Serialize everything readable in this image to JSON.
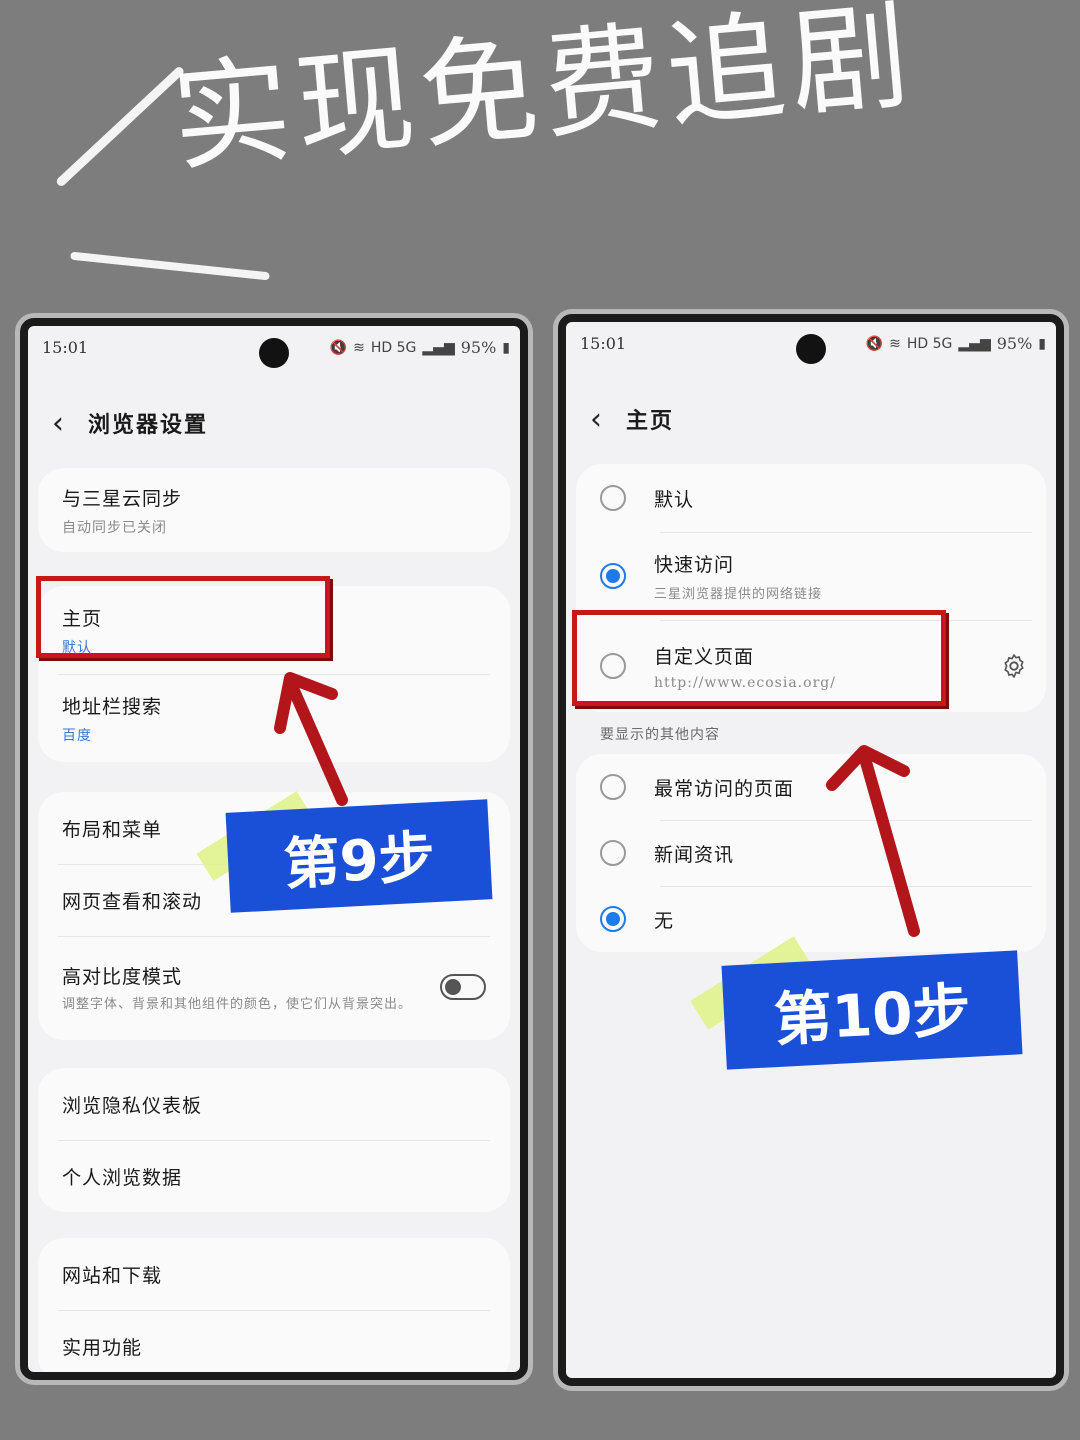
{
  "headline": "实现免费追剧",
  "left_phone": {
    "status": {
      "time": "15:01",
      "battery": "95%",
      "network": "HD 5G"
    },
    "title": "浏览器设置",
    "group1": [
      {
        "label": "与三星云同步",
        "sub": "自动同步已关闭"
      }
    ],
    "group2": [
      {
        "label": "主页",
        "sub": "默认"
      },
      {
        "label": "地址栏搜索",
        "sub": "百度"
      }
    ],
    "group3": [
      {
        "label": "布局和菜单"
      },
      {
        "label": "网页查看和滚动"
      },
      {
        "label": "高对比度模式",
        "sub": "调整字体、背景和其他组件的颜色，使它们从背景突出。",
        "toggle_on": false
      }
    ],
    "group4": [
      {
        "label": "浏览隐私仪表板"
      },
      {
        "label": "个人浏览数据"
      }
    ],
    "group5": [
      {
        "label": "网站和下载"
      },
      {
        "label": "实用功能"
      }
    ],
    "step_label": "第9步"
  },
  "right_phone": {
    "status": {
      "time": "15:01",
      "battery": "95%",
      "network": "HD 5G"
    },
    "title": "主页",
    "options": [
      {
        "label": "默认",
        "selected": false
      },
      {
        "label": "快速访问",
        "sub": "三星浏览器提供的网络链接",
        "selected": true
      },
      {
        "label": "自定义页面",
        "sub": "http://www.ecosia.org/",
        "selected": false,
        "icon": "gear-icon"
      }
    ],
    "section_title": "要显示的其他内容",
    "other": [
      {
        "label": "最常访问的页面",
        "selected": false
      },
      {
        "label": "新闻资讯",
        "selected": false
      },
      {
        "label": "无",
        "selected": true
      }
    ],
    "step_label": "第10步"
  },
  "colors": {
    "background": "#7d7d7d",
    "highlight_box": "#c9161b",
    "step_badge": "#1a4fd8",
    "radio_selected": "#1e7ae8",
    "tape": "#dff18a"
  }
}
